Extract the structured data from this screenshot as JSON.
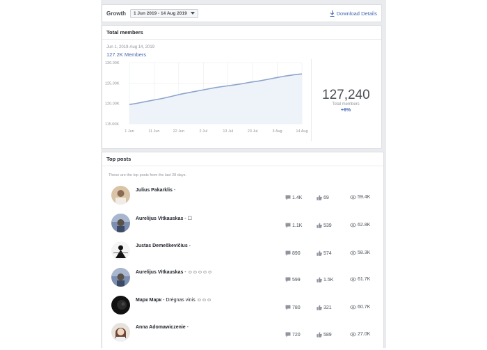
{
  "header": {
    "label": "Growth",
    "date_range": "1 Jun 2019 - 14 Aug 2019",
    "download": "Download Details"
  },
  "members": {
    "title": "Total members",
    "range": "Jun 1, 2019-Aug 14, 2019",
    "value_small": "127.2K Members",
    "big_number": "127,240",
    "big_label": "Total members",
    "change": "+6%"
  },
  "chart_data": {
    "type": "area",
    "title": "",
    "xlabel": "",
    "ylabel": "",
    "x_ticks": [
      "1 Jun",
      "11 Jun",
      "22 Jun",
      "2 Jul",
      "13 Jul",
      "23 Jul",
      "3 Aug",
      "14 Aug"
    ],
    "y_ticks": [
      "115.00K",
      "120.00K",
      "125.00K",
      "130.00K"
    ],
    "ylim": [
      115000,
      130000
    ],
    "grid": true,
    "series": [
      {
        "values": [
          119700,
          120100,
          120500,
          120900,
          121300,
          121800,
          122300,
          122700,
          123100,
          123500,
          123900,
          124200,
          124500,
          124800,
          125200,
          125500,
          125900,
          126300,
          126700,
          127000,
          127240
        ]
      }
    ],
    "x": [
      "1 Jun",
      "5 Jun",
      "8 Jun",
      "12 Jun",
      "15 Jun",
      "19 Jun",
      "22 Jun",
      "26 Jun",
      "29 Jun",
      "3 Jul",
      "6 Jul",
      "10 Jul",
      "13 Jul",
      "17 Jul",
      "20 Jul",
      "24 Jul",
      "27 Jul",
      "31 Jul",
      "3 Aug",
      "7 Aug",
      "14 Aug"
    ]
  },
  "posts": {
    "title": "Top posts",
    "subtitle": "These are the top posts from the last 28 days.",
    "items": [
      {
        "author": "Julius Pakarklis",
        "text": " -",
        "comments": "1.4K",
        "likes": "69",
        "views": "59.4K"
      },
      {
        "author": "Aurelijus Vitkauskas",
        "text": " - ☐",
        "comments": "1.1K",
        "likes": "539",
        "views": "62.8K"
      },
      {
        "author": "Justas Demeškevičius",
        "text": " -",
        "comments": "890",
        "likes": "574",
        "views": "58.3K"
      },
      {
        "author": "Aurelijus Vitkauskas",
        "text": " - ☺☺☺☺☺",
        "comments": "599",
        "likes": "1.5K",
        "views": "61.7K"
      },
      {
        "author": "Марк Марк",
        "text": " - Drėgnas vinis ☺☺☺",
        "comments": "780",
        "likes": "321",
        "views": "60.7K"
      },
      {
        "author": "Anna Adomawiczenie",
        "text": " -",
        "comments": "720",
        "likes": "589",
        "views": "27.0K"
      }
    ]
  },
  "colors": {
    "accent": "#4267b2",
    "line": "#8ca4cc",
    "area": "#eef2f9"
  }
}
